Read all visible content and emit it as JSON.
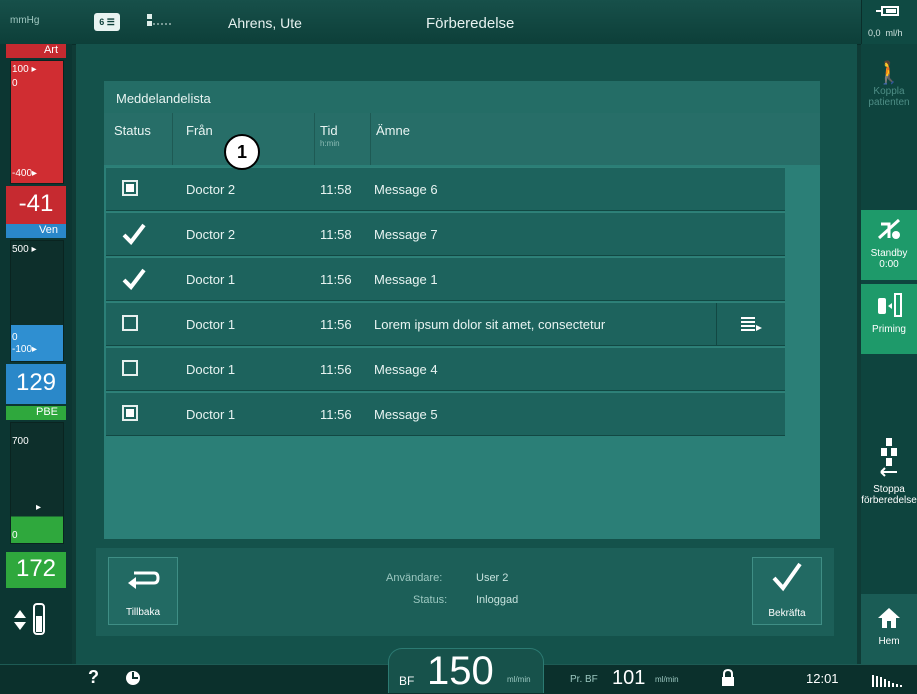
{
  "topbar": {
    "unit": "mmHg",
    "card_label": "6",
    "patient": "Ahrens, Ute",
    "mode": "Förberedelse",
    "flow_value": "0,0",
    "flow_unit": "ml/h"
  },
  "pressures": [
    {
      "name": "Art",
      "scale_top": "100 ▸",
      "scale_mid": "0",
      "scale_low": "-400▸",
      "value": "-41",
      "color": "#d02d32",
      "fill_fraction": 0.62
    },
    {
      "name": "Ven",
      "scale_top": "500 ▸",
      "scale_mid": "0",
      "scale_low": "-100▸",
      "value": "129",
      "color": "#2f8fd1",
      "fill_fraction": 0.3
    },
    {
      "name": "PBE",
      "scale_top": "700",
      "scale_mid": "0",
      "scale_low": "▸",
      "value": "172",
      "color": "#2fa83d",
      "fill_fraction": 0.22
    }
  ],
  "right_buttons": {
    "patient_label": "Koppla patienten",
    "standby_label": "Standby",
    "standby_time": "0:00",
    "priming_label": "Priming",
    "stop_label": "Stoppa förberedelse",
    "home_label": "Hem"
  },
  "message_list": {
    "title": "Meddelandelista",
    "columns": {
      "status": "Status",
      "from": "Från",
      "time": "Tid",
      "time_unit": "h:min",
      "subject": "Ämne"
    },
    "marker": "1",
    "rows": [
      {
        "status": "unread",
        "from": "Doctor 2",
        "time": "11:58",
        "subject": "Message 6"
      },
      {
        "status": "confirmed",
        "from": "Doctor 2",
        "time": "11:58",
        "subject": "Message 7"
      },
      {
        "status": "confirmed",
        "from": "Doctor 1",
        "time": "11:56",
        "subject": "Message 1"
      },
      {
        "status": "read",
        "from": "Doctor 1",
        "time": "11:56",
        "subject": "Lorem ipsum dolor sit amet, consectetur",
        "has_more": true
      },
      {
        "status": "read",
        "from": "Doctor 1",
        "time": "11:56",
        "subject": "Message 4"
      },
      {
        "status": "unread",
        "from": "Doctor 1",
        "time": "11:56",
        "subject": "Message 5"
      }
    ]
  },
  "footer": {
    "back_label": "Tillbaka",
    "user_label": "Användare:",
    "user_value": "User 2",
    "status_label": "Status:",
    "status_value": "Inloggad",
    "confirm_label": "Bekräfta"
  },
  "bottombar": {
    "help": "?",
    "bf_label": "BF",
    "bf_value": "150",
    "bf_unit": "ml/min",
    "prbf_label": "Pr. BF",
    "prbf_value": "101",
    "prbf_unit": "ml/min",
    "clock": "12:01"
  }
}
